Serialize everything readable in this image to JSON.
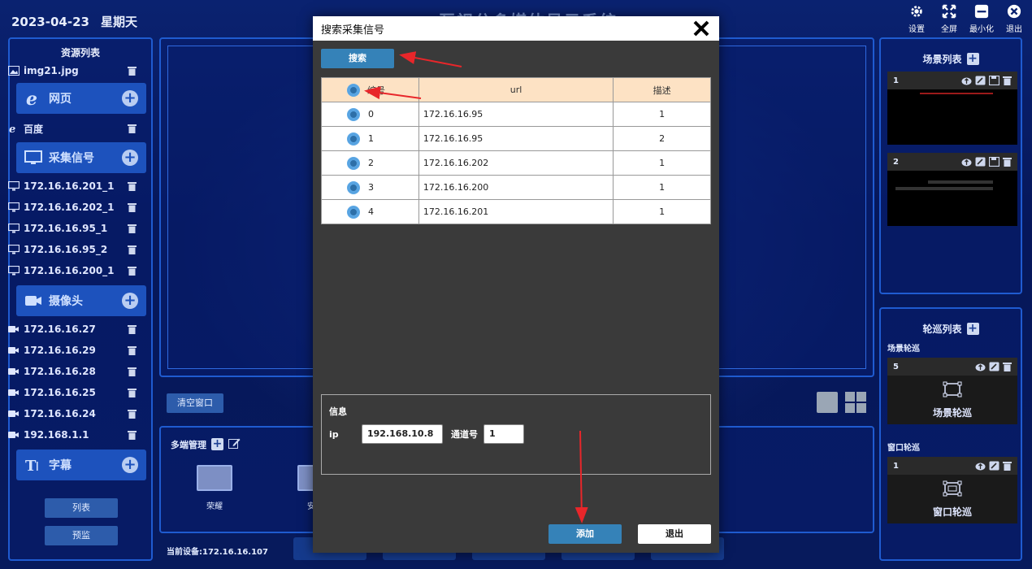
{
  "header": {
    "date": "2023-04-23",
    "weekday": "星期天",
    "title": "互视分多媒体显示系统",
    "buttons": [
      {
        "label": "设置",
        "icon": "gear-icon"
      },
      {
        "label": "全屏",
        "icon": "fullscreen-icon"
      },
      {
        "label": "最小化",
        "icon": "minimize-icon"
      },
      {
        "label": "退出",
        "icon": "exit-icon"
      }
    ]
  },
  "left": {
    "title": "资源列表",
    "top_item": "img21.jpg",
    "web_cat": "网页",
    "web_items": [
      "百度"
    ],
    "capture_cat": "采集信号",
    "capture_items": [
      "172.16.16.201_1",
      "172.16.16.202_1",
      "172.16.16.95_1",
      "172.16.16.95_2",
      "172.16.16.200_1"
    ],
    "camera_cat": "摄像头",
    "camera_items": [
      "172.16.16.27",
      "172.16.16.29",
      "172.16.16.28",
      "172.16.16.25",
      "172.16.16.24",
      "192.168.1.1"
    ],
    "subtitle_cat": "字幕",
    "list_btn": "列表",
    "preview_btn": "预监"
  },
  "center": {
    "clear_btn": "清空窗口",
    "multi_title": "多端管理",
    "devices": [
      "荣耀",
      "安卓"
    ],
    "current_device": "当前设备:172.16.16.107"
  },
  "right": {
    "scene_title": "场景列表",
    "scenes": [
      {
        "id": "1"
      },
      {
        "id": "2"
      }
    ],
    "tour_title": "轮巡列表",
    "scene_tour_label": "场景轮巡",
    "scene_tour": {
      "id": "5",
      "name": "场景轮巡"
    },
    "window_tour_label": "窗口轮巡",
    "window_tour": {
      "id": "1",
      "name": "窗口轮巡"
    }
  },
  "modal": {
    "title": "搜索采集信号",
    "search_btn": "搜索",
    "columns": [
      "编号",
      "url",
      "描述"
    ],
    "rows": [
      {
        "id": "0",
        "url": "172.16.16.95",
        "desc": "1"
      },
      {
        "id": "1",
        "url": "172.16.16.95",
        "desc": "2"
      },
      {
        "id": "2",
        "url": "172.16.16.202",
        "desc": "1"
      },
      {
        "id": "3",
        "url": "172.16.16.200",
        "desc": "1"
      },
      {
        "id": "4",
        "url": "172.16.16.201",
        "desc": "1"
      }
    ],
    "info_title": "信息",
    "ip_label": "ip",
    "ip_value": "192.168.10.8",
    "channel_label": "通道号",
    "channel_value": "1",
    "add_btn": "添加",
    "exit_btn": "退出"
  },
  "colors": {
    "accent": "#3582b8",
    "panel_border": "#1f5bd0",
    "annotation_arrow": "#e8262a"
  }
}
